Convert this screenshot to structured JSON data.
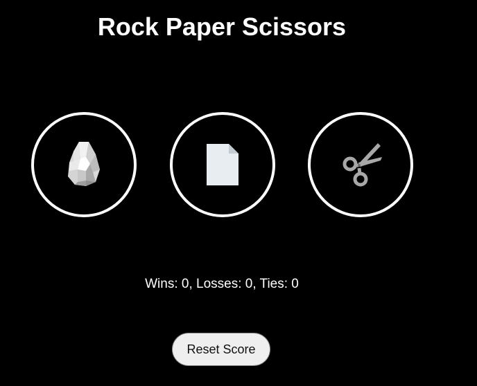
{
  "title": "Rock Paper Scissors",
  "moves": [
    {
      "name": "rock",
      "icon": "rock-icon"
    },
    {
      "name": "paper",
      "icon": "paper-icon"
    },
    {
      "name": "scissors",
      "icon": "scissors-icon"
    }
  ],
  "score": {
    "text": "Wins: 0, Losses: 0, Ties: 0",
    "wins": 0,
    "losses": 0,
    "ties": 0
  },
  "reset_label": "Reset Score",
  "colors": {
    "background": "#000000",
    "text": "#ffffff",
    "button_border": "#ffffff",
    "reset_background": "#efefef"
  }
}
